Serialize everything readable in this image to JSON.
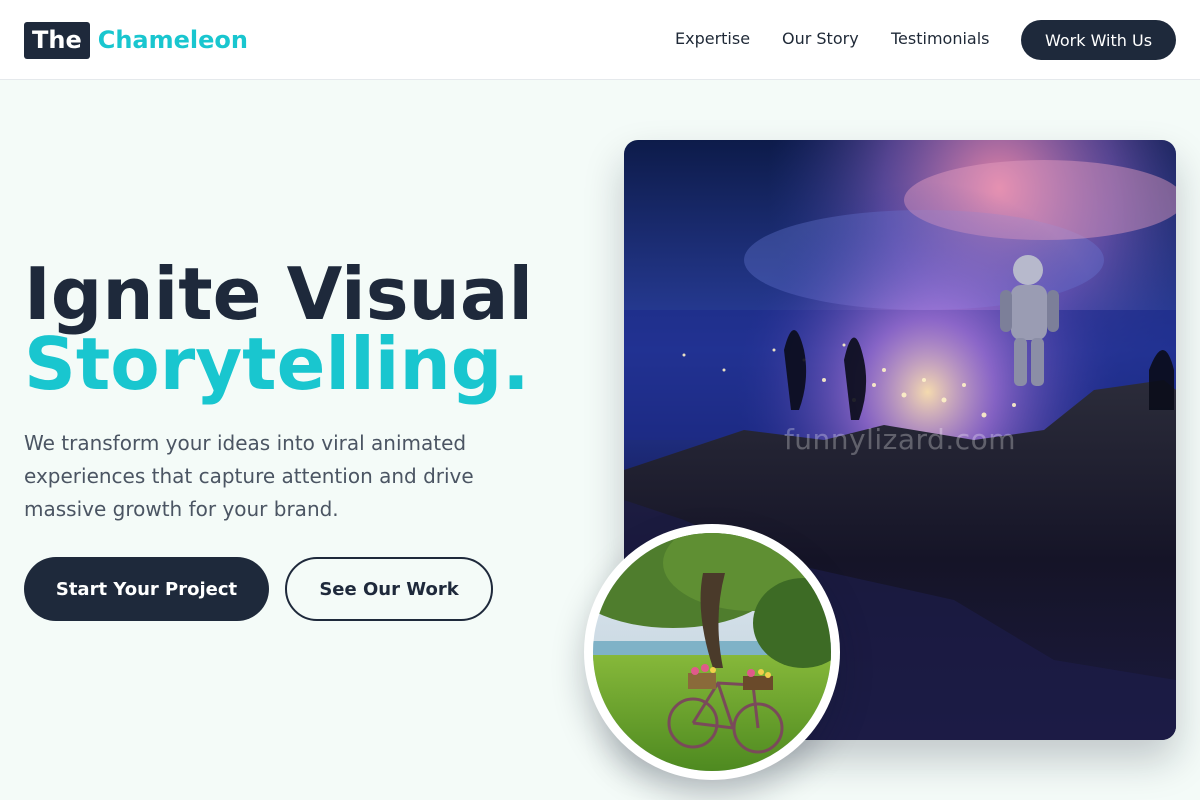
{
  "nav": {
    "logo_box": "The",
    "logo_word": "Chameleon",
    "links": [
      "Expertise",
      "Our Story",
      "Testimonials"
    ],
    "cta": "Work With Us"
  },
  "hero": {
    "title_line1": "Ignite Visual",
    "title_line2": "Storytelling.",
    "description": "We transform your ideas into viral animated experiences that capture attention and drive massive growth for your brand.",
    "primary_button": "Start Your Project",
    "secondary_button": "See Our Work",
    "image_watermark": "funnylizard.com"
  },
  "colors": {
    "brand_dark": "#1e293b",
    "accent_teal": "#19c6cf",
    "page_background": "#f4fbf8"
  },
  "images": {
    "main": "astronaut-on-cliff-night-city",
    "inset": "bicycle-with-flowers-by-river"
  }
}
